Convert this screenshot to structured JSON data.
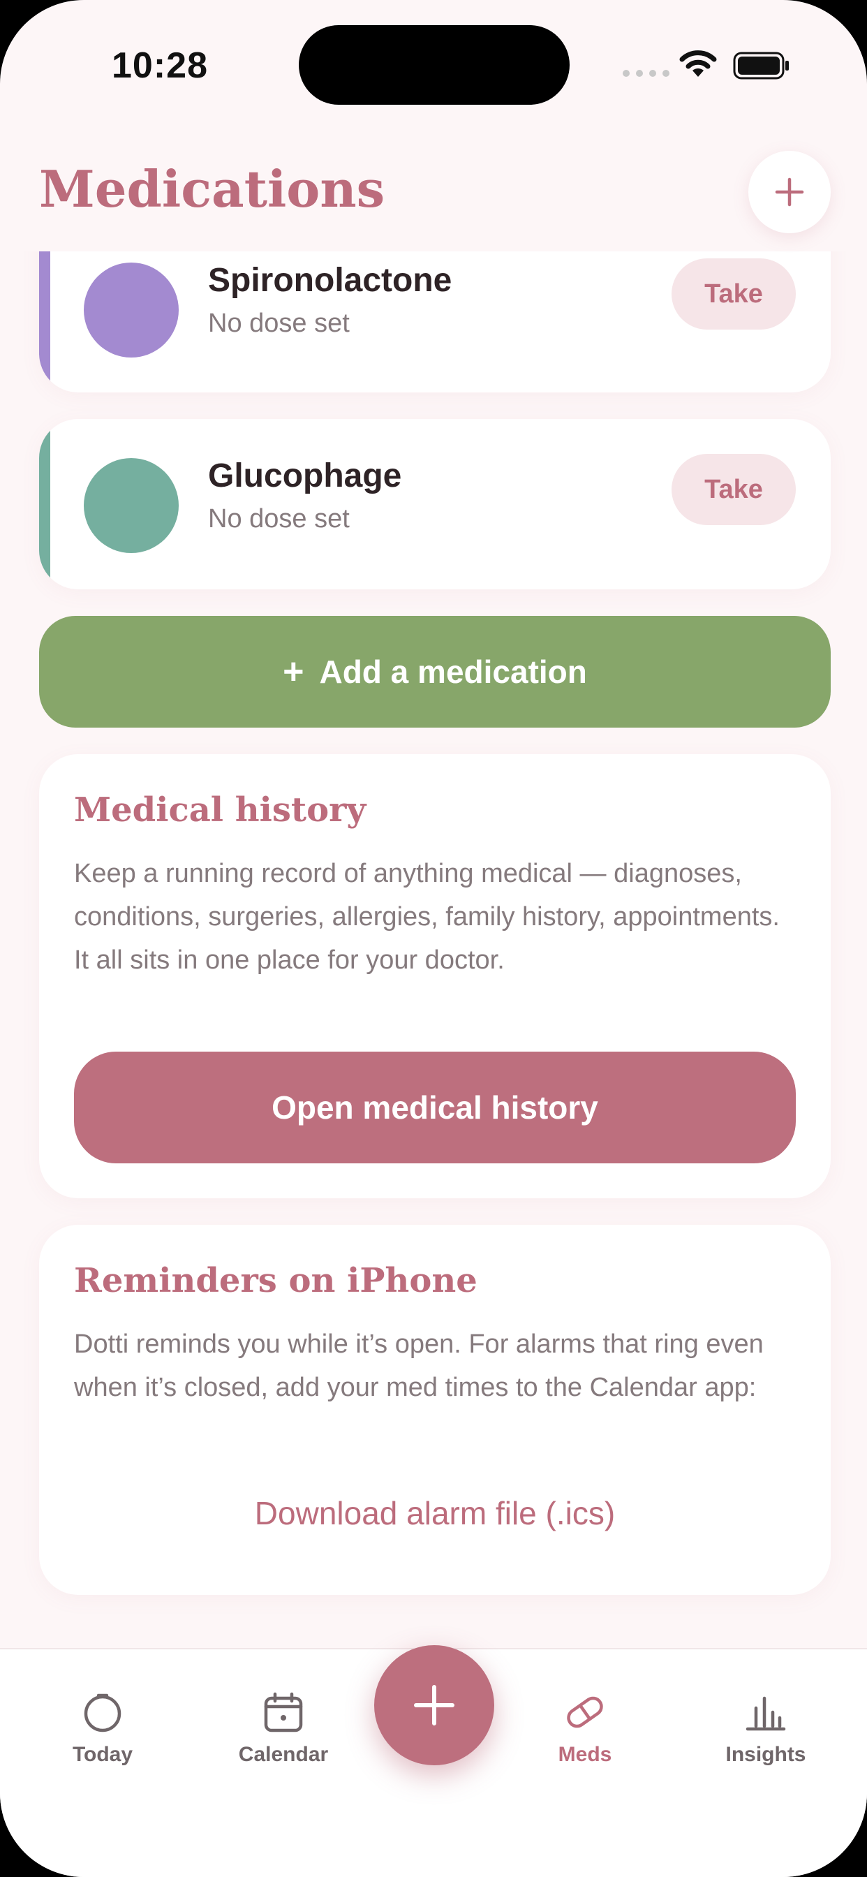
{
  "status_bar": {
    "time": "10:28"
  },
  "header": {
    "title": "Medications"
  },
  "medications": [
    {
      "name": "Spironolactone",
      "dose": "No dose set",
      "color": "#a38ad0",
      "take_label": "Take"
    },
    {
      "name": "Glucophage",
      "dose": "No dose set",
      "color": "#75af9f",
      "take_label": "Take"
    }
  ],
  "add_medication": {
    "icon": "+",
    "label": "Add a medication"
  },
  "medical_history": {
    "title": "Medical history",
    "description": "Keep a running record of anything medical — diagnoses, conditions, surgeries, allergies, family history, appointments. It all sits in one place for your doctor.",
    "button_label": "Open medical history"
  },
  "reminders": {
    "title": "Reminders on iPhone",
    "description": "Dotti reminds you while it’s open. For alarms that ring even when it’s closed, add your med times to the Calendar app:",
    "link_label": "Download alarm file (.ics)"
  },
  "tab_bar": {
    "tabs": [
      {
        "label": "Today",
        "icon": "today-icon"
      },
      {
        "label": "Calendar",
        "icon": "calendar-icon"
      },
      {
        "label": "Meds",
        "icon": "pill-icon",
        "active": true
      },
      {
        "label": "Insights",
        "icon": "chart-icon"
      }
    ]
  },
  "colors": {
    "accent": "#bc6c7c",
    "green": "#87a66a",
    "background": "#fdf6f7"
  }
}
